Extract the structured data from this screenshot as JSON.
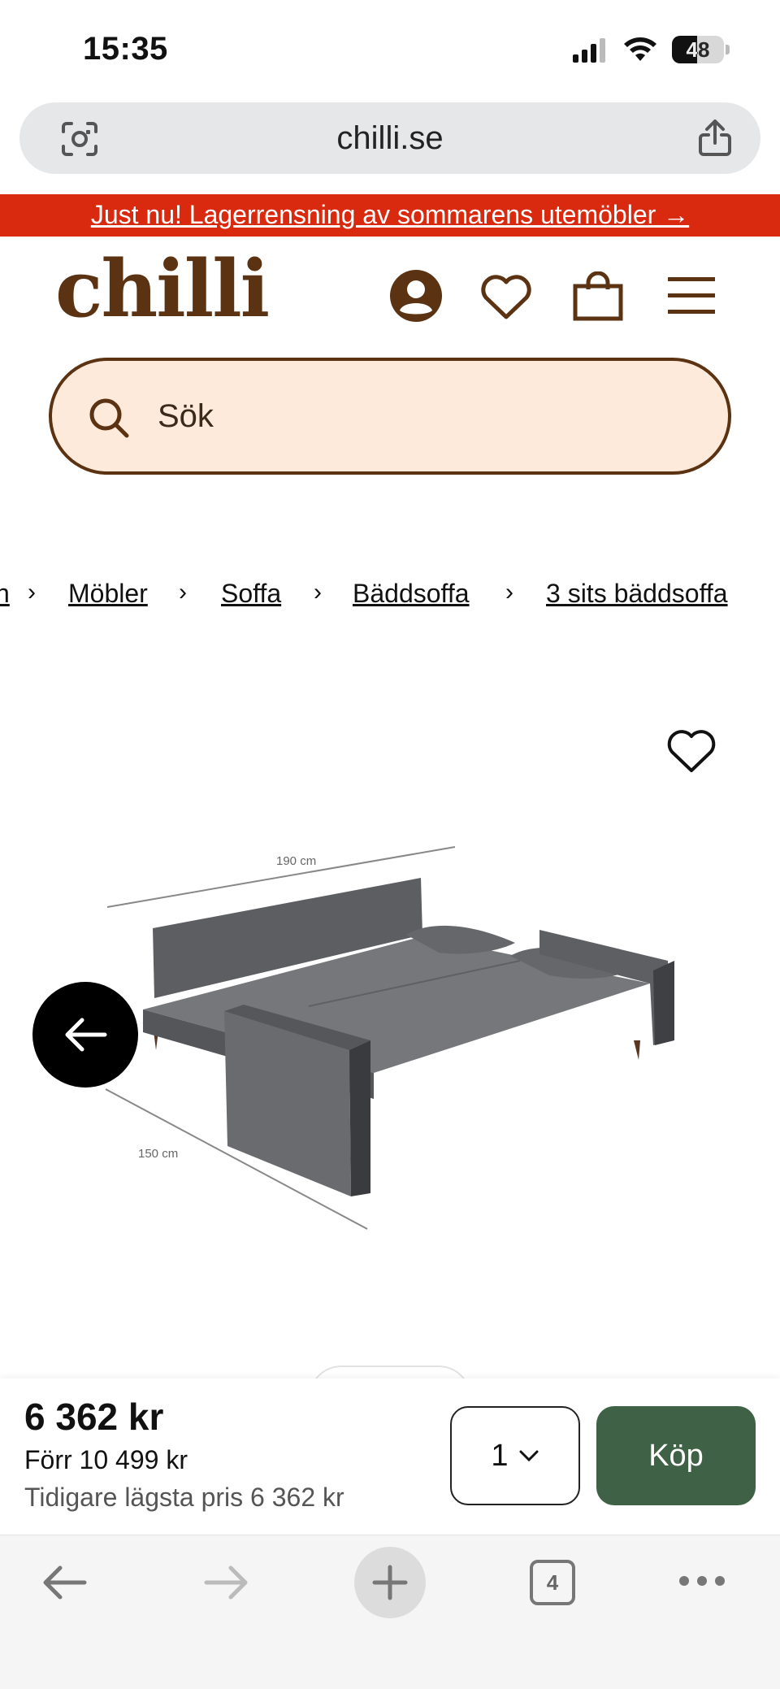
{
  "status_bar": {
    "time": "15:35",
    "battery_level": "48",
    "battery_fraction": 0.48,
    "icons": [
      "signal-icon",
      "wifi-icon",
      "battery-icon"
    ]
  },
  "browser": {
    "url": "chilli.se",
    "left_icon": "camera-search-icon",
    "right_icon": "share-icon"
  },
  "promo": {
    "text": "Just nu! Lagerrensning av sommarens utemöbler →",
    "background": "#d9290f"
  },
  "header": {
    "logo": "chilli",
    "brand_color": "#5b3212",
    "icons": [
      "account-icon",
      "wishlist-heart-icon",
      "shopping-bag-icon",
      "menu-icon"
    ]
  },
  "search": {
    "placeholder": "Sök",
    "value": "",
    "background": "#fdeadb"
  },
  "breadcrumb": {
    "first_partial": "n",
    "items": [
      "Möbler",
      "Soffa",
      "Bäddsoffa",
      "3 sits bäddsoffa"
    ],
    "separator": "›"
  },
  "product_image": {
    "dimension_width": "190 cm",
    "dimension_depth": "150 cm",
    "favorite_icon": "heart-outline-icon",
    "prev_icon": "arrow-left-icon"
  },
  "purchase": {
    "price": "6 362 kr",
    "price_before": "Förr 10 499 kr",
    "lowest_price": "Tidigare lägsta pris 6 362 kr",
    "quantity": "1",
    "buy_label": "Köp",
    "buy_color": "#3f6246"
  },
  "bottom_nav": {
    "tab_count": "4",
    "icons": [
      "back-arrow-icon",
      "forward-arrow-icon",
      "new-tab-plus-icon",
      "tabs-icon",
      "more-dots-icon"
    ]
  }
}
